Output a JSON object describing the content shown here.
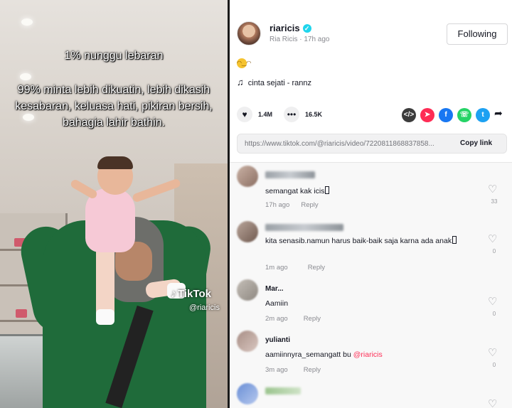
{
  "video": {
    "overlay_line1": "1% nunggu lebaran",
    "overlay_line2": "99% minta lebih dikuatin, lebih dikasih kesabaran, keluasa hati, pikiran bersih, bahagia lahir bathin.",
    "watermark_logo": "TikTok",
    "watermark_handle": "@riaricis"
  },
  "post": {
    "username": "riaricis",
    "display_name": "Ria Ricis",
    "time_ago": "17h ago",
    "follow_label": "Following",
    "caption_emoji": "😁",
    "music": "cinta sejati - rannz",
    "likes": "1.4M",
    "comments_count": "16.5K",
    "link_url": "https://www.tiktok.com/@riaricis/video/7220811868837858...",
    "copy_link_label": "Copy link"
  },
  "comments": [
    {
      "name": "",
      "text": "semangat kak icis",
      "time": "17h ago",
      "reply": "Reply",
      "likes": "33"
    },
    {
      "name": "",
      "text": "kita senasib.namun harus baik-baik saja karna ada anak",
      "time": "1m ago",
      "reply": "Reply",
      "likes": "0"
    },
    {
      "name": "Mar...",
      "text": "Aamiin",
      "time": "2m ago",
      "reply": "Reply",
      "likes": "0"
    },
    {
      "name": "yulianti",
      "text": "aamiinnyra_semangatt bu ",
      "mention": "@riaricis",
      "time": "3m ago",
      "reply": "Reply",
      "likes": "0"
    }
  ],
  "colors": {
    "accent_mention": "#fe2c55",
    "verified": "#20d5ec"
  }
}
